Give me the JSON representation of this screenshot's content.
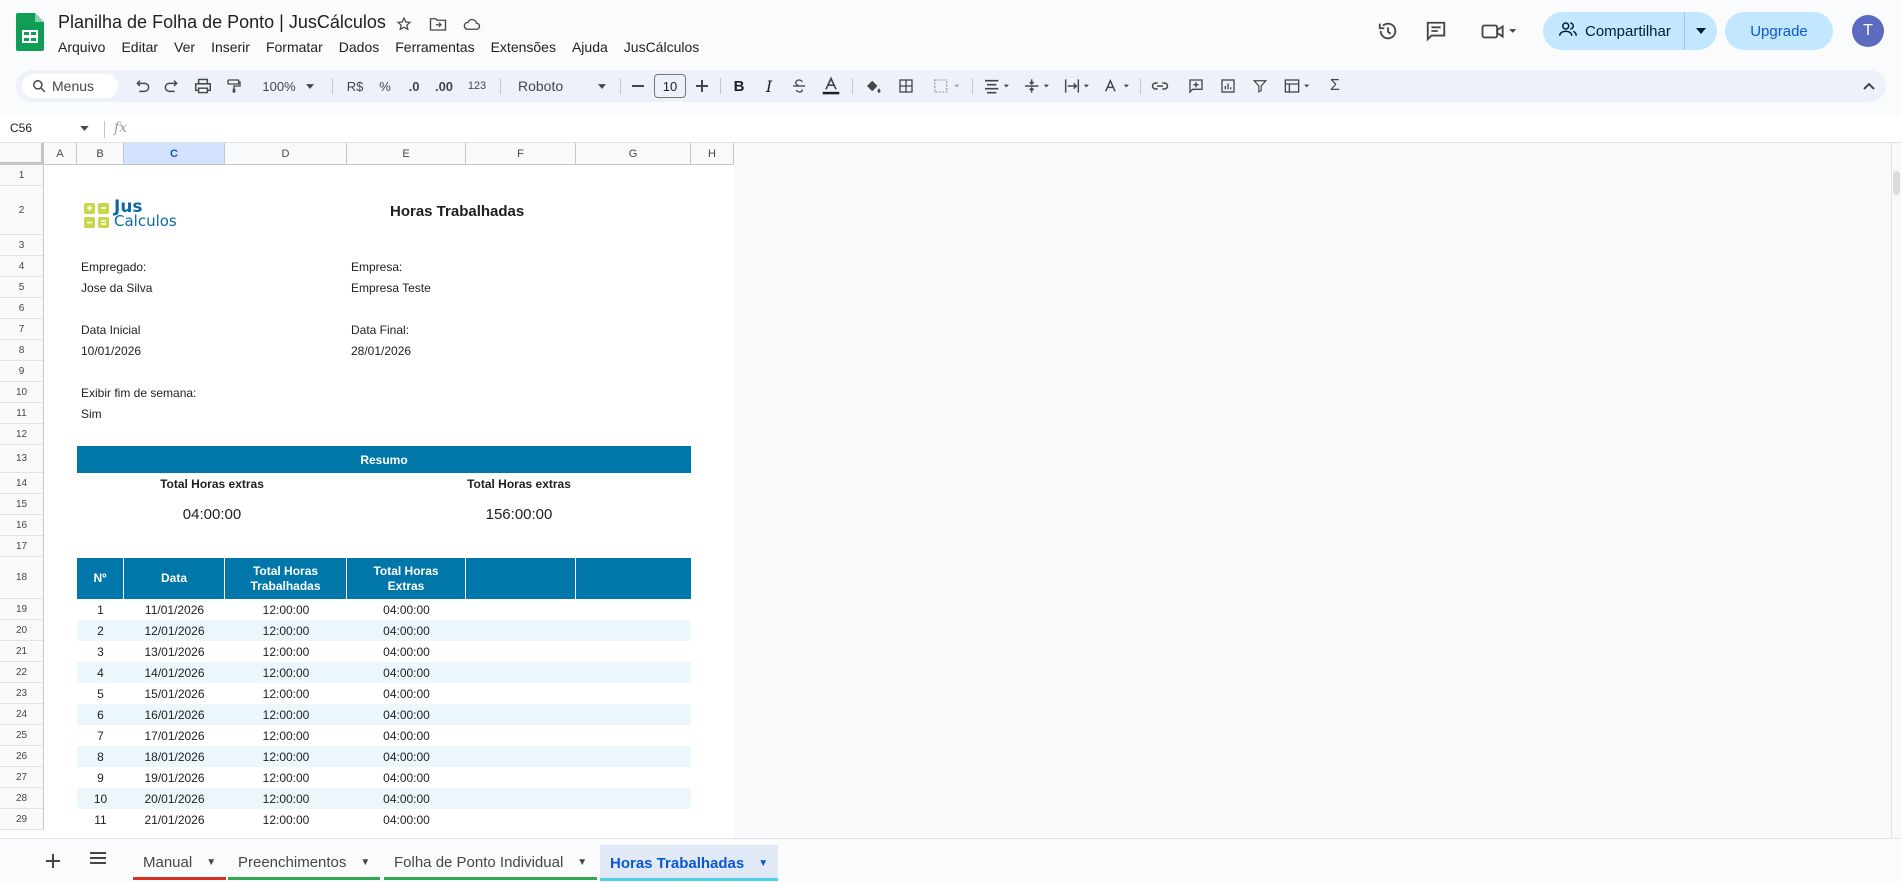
{
  "header": {
    "title": "Planilha de Folha de Ponto | JusCálculos",
    "menus": [
      "Arquivo",
      "Editar",
      "Ver",
      "Inserir",
      "Formatar",
      "Dados",
      "Ferramentas",
      "Extensões",
      "Ajuda",
      "JusCálculos"
    ],
    "share_label": "Compartilhar",
    "upgrade_label": "Upgrade",
    "avatar_initial": "T"
  },
  "toolbar": {
    "search_label": "Menus",
    "zoom": "100%",
    "currency": "R$",
    "percent": "%",
    "dec_decrease": ".0",
    "dec_increase": ".00",
    "number_format": "123",
    "font": "Roboto",
    "font_size": "10"
  },
  "formula_bar": {
    "cell_ref": "C56",
    "fx_label": "fx"
  },
  "columns": [
    "A",
    "B",
    "C",
    "D",
    "E",
    "F",
    "G",
    "H"
  ],
  "rows": [
    "1",
    "2",
    "3",
    "4",
    "5",
    "6",
    "7",
    "8",
    "9",
    "10",
    "11",
    "12",
    "13",
    "14",
    "15",
    "16",
    "17",
    "18",
    "19",
    "20",
    "21",
    "22",
    "23",
    "24",
    "25",
    "26",
    "27",
    "28",
    "29"
  ],
  "sheet": {
    "brand_top": "Jus",
    "brand_bottom": "Calculos",
    "title": "Horas Trabalhadas",
    "employee_label": "Empregado:",
    "employee_value": "Jose da Silva",
    "company_label": "Empresa:",
    "company_value": "Empresa Teste",
    "start_label": "Data Inicial",
    "start_value": "10/01/2026",
    "end_label": "Data Final:",
    "end_value": "28/01/2026",
    "weekend_label": "Exibir fim de semana:",
    "weekend_value": "Sim",
    "summary_title": "Resumo",
    "summary_left_label": "Total Horas extras",
    "summary_left_value": "04:00:00",
    "summary_right_label": "Total Horas extras",
    "summary_right_value": "156:00:00",
    "table_headers": [
      "Nº",
      "Data",
      "Total Horas Trabalhadas",
      "Total Horas Extras",
      "",
      ""
    ],
    "table_rows": [
      [
        "1",
        "11/01/2026",
        "12:00:00",
        "04:00:00"
      ],
      [
        "2",
        "12/01/2026",
        "12:00:00",
        "04:00:00"
      ],
      [
        "3",
        "13/01/2026",
        "12:00:00",
        "04:00:00"
      ],
      [
        "4",
        "14/01/2026",
        "12:00:00",
        "04:00:00"
      ],
      [
        "5",
        "15/01/2026",
        "12:00:00",
        "04:00:00"
      ],
      [
        "6",
        "16/01/2026",
        "12:00:00",
        "04:00:00"
      ],
      [
        "7",
        "17/01/2026",
        "12:00:00",
        "04:00:00"
      ],
      [
        "8",
        "18/01/2026",
        "12:00:00",
        "04:00:00"
      ],
      [
        "9",
        "19/01/2026",
        "12:00:00",
        "04:00:00"
      ],
      [
        "10",
        "20/01/2026",
        "12:00:00",
        "04:00:00"
      ],
      [
        "11",
        "21/01/2026",
        "12:00:00",
        "04:00:00"
      ]
    ]
  },
  "tabs": [
    {
      "label": "Manual",
      "color": "#d93025"
    },
    {
      "label": "Preenchimentos",
      "color": "#34a853"
    },
    {
      "label": "Folha de Ponto Individual",
      "color": "#34a853"
    },
    {
      "label": "Horas Trabalhadas",
      "color": "#4dd0e1",
      "active": true
    }
  ],
  "colors": {
    "accent": "#0077a8",
    "row_alt": "#ebf7fb",
    "share_bg": "#c2e7ff"
  }
}
